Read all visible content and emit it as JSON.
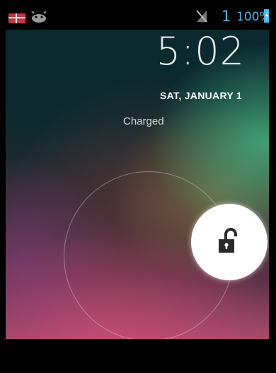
{
  "status_bar": {
    "notification_icons": [
      "flag-calendar-icon",
      "android-debug-icon"
    ],
    "signal_icon": "no-signal-icon",
    "network_number": "1",
    "battery_percent": "100%",
    "battery_icon": "battery-charging-icon",
    "accent_color": "#4fb3e8"
  },
  "lockscreen": {
    "time": "5:02",
    "date": "SAT, JANUARY 1",
    "status": "Charged",
    "unlock_icon": "unlocked-padlock-icon"
  }
}
